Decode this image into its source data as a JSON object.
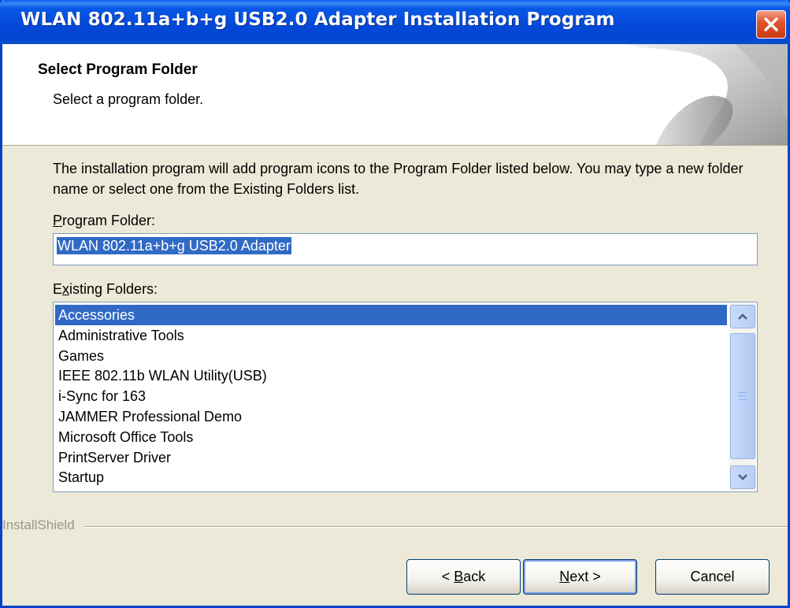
{
  "window": {
    "title": "WLAN 802.11a+b+g USB2.0 Adapter Installation Program"
  },
  "header": {
    "title": "Select Program Folder",
    "subtitle": "Select a program folder."
  },
  "body": {
    "description": "The installation program will add program icons to the Program Folder listed below. You may type a new folder name or select one from the Existing Folders list.",
    "program_folder_label_accel": "P",
    "program_folder_label_rest": "rogram Folder:",
    "program_folder_value": "WLAN 802.11a+b+g USB2.0 Adapter",
    "existing_folders_label_pre": "E",
    "existing_folders_label_accel": "x",
    "existing_folders_label_rest": "isting Folders:",
    "folders": [
      "Accessories",
      "Administrative Tools",
      "Games",
      "IEEE 802.11b WLAN Utility(USB)",
      "i-Sync for 163",
      "JAMMER Professional Demo",
      "Microsoft Office Tools",
      "PrintServer Driver",
      "Startup"
    ],
    "selected_folder": "Accessories"
  },
  "footer": {
    "brand": "InstallShield",
    "back_pre": "< ",
    "back_accel": "B",
    "back_rest": "ack",
    "next_accel": "N",
    "next_rest": "ext >",
    "cancel": "Cancel"
  },
  "colors": {
    "titlebar": "#0448d8",
    "selection": "#316ac5",
    "close": "#e2562d"
  }
}
